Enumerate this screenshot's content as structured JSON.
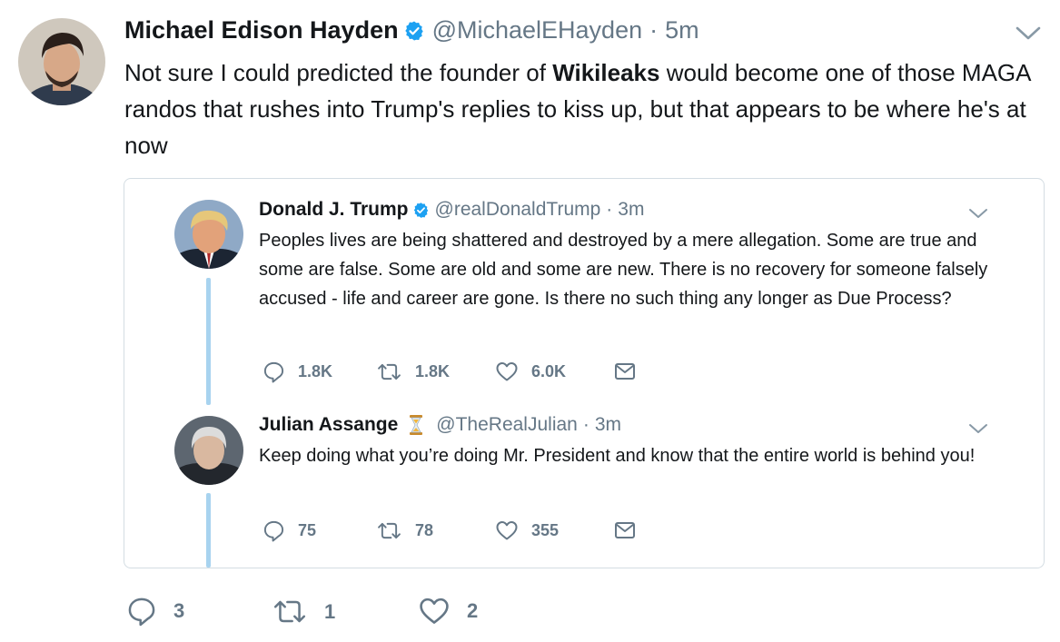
{
  "main_tweet": {
    "name": "Michael Edison Hayden",
    "handle": "@MichaelEHayden",
    "separator": "·",
    "time": "5m",
    "text_before": "Not sure I could predicted the founder of ",
    "text_bold": "Wikileaks",
    "text_after": " would become one of those MAGA randos that rushes into Trump's replies to kiss up, but that appears to be where he's at now",
    "reply_count": "3",
    "retweet_count": "1",
    "like_count": "2"
  },
  "quoted_thread": [
    {
      "name": "Donald J. Trump",
      "handle": "@realDonaldTrump",
      "separator": "·",
      "time": "3m",
      "text": "Peoples lives are being shattered and destroyed by a mere allegation. Some are true and some are false. Some are old and some are new. There is no recovery for someone falsely accused - life and career are gone. Is there no such thing any longer as Due Process?",
      "reply_count": "1.8K",
      "retweet_count": "1.8K",
      "like_count": "6.0K"
    },
    {
      "name": "Julian Assange",
      "handle": "@TheRealJulian",
      "separator": "·",
      "time": "3m",
      "text": "Keep doing what you’re doing Mr. President and know that the entire world is behind you!",
      "reply_count": "75",
      "retweet_count": "78",
      "like_count": "355"
    }
  ],
  "icons": {
    "verified": "verified-badge-icon",
    "hourglass": "hourglass-emoji-icon",
    "reply": "reply-icon",
    "retweet": "retweet-icon",
    "like": "heart-icon",
    "dm": "envelope-icon",
    "more": "chevron-down-icon"
  },
  "colors": {
    "verified_blue": "#1da1f2",
    "thread_line": "#a8d3ef",
    "secondary_text": "#657786",
    "primary_text": "#14171a",
    "quote_border": "#d4dde3"
  }
}
